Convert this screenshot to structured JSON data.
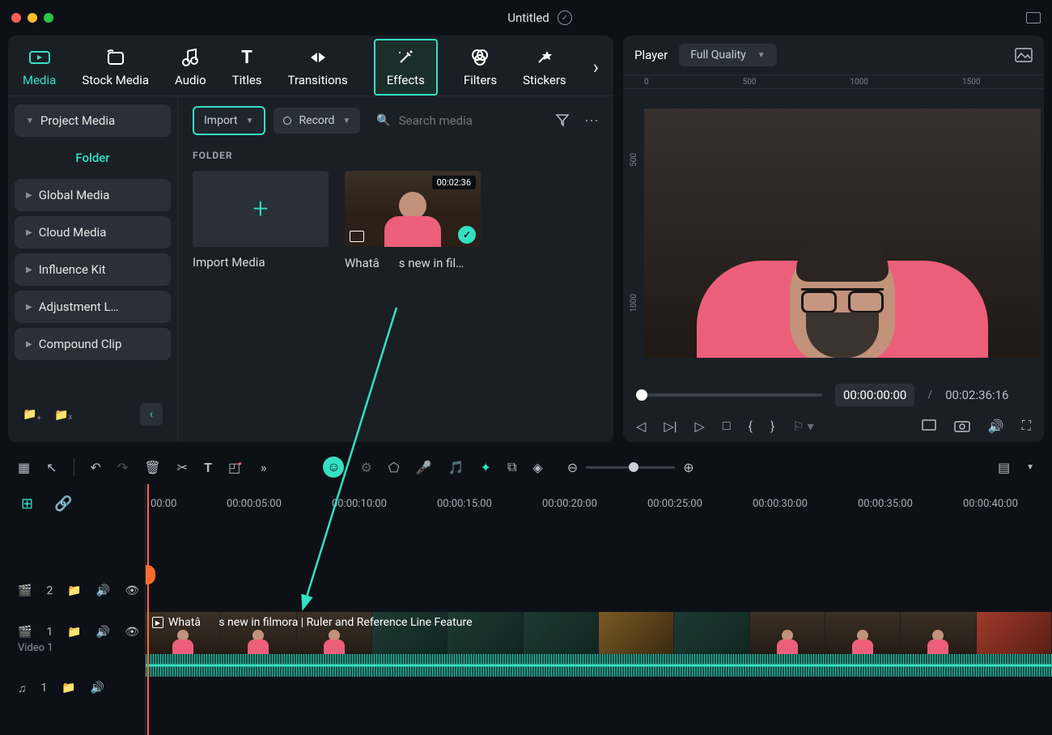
{
  "title": "Untitled",
  "traffic": {
    "red": "#ff5f57",
    "yellow": "#febc2e",
    "green": "#28c840"
  },
  "tabs": [
    "Media",
    "Stock Media",
    "Audio",
    "Titles",
    "Transitions",
    "Effects",
    "Filters",
    "Stickers"
  ],
  "activeTab": "Media",
  "highlightTab": "Effects",
  "sidebar": {
    "top": "Project Media",
    "active": "Folder",
    "items": [
      "Global Media",
      "Cloud Media",
      "Influence Kit",
      "Adjustment L…",
      "Compound Clip"
    ]
  },
  "toolbar": {
    "import": "Import",
    "record": "Record",
    "searchPlaceholder": "Search media"
  },
  "folderLabel": "FOLDER",
  "cards": {
    "importLabel": "Import Media",
    "videoDuration": "00:02:36",
    "videoLabel": "Whatâs new in fil…"
  },
  "player": {
    "label": "Player",
    "quality": "Full Quality",
    "rulerH": [
      "0",
      "500",
      "1000",
      "1500"
    ],
    "rulerV": [
      "500",
      "1000"
    ],
    "current": "00:00:00:00",
    "sep": "/",
    "total": "00:02:36:16"
  },
  "timeline": {
    "marks": [
      "00:00",
      "00:00:05:00",
      "00:00:10:00",
      "00:00:15:00",
      "00:00:20:00",
      "00:00:25:00",
      "00:00:30:00",
      "00:00:35:00",
      "00:00:40:00"
    ],
    "clipTitle": "Whatâs new in filmora | Ruler and Reference Line Feature",
    "track2": {
      "num": "2"
    },
    "track1": {
      "num": "1",
      "label": "Video 1"
    },
    "audio": {
      "num": "1"
    }
  }
}
